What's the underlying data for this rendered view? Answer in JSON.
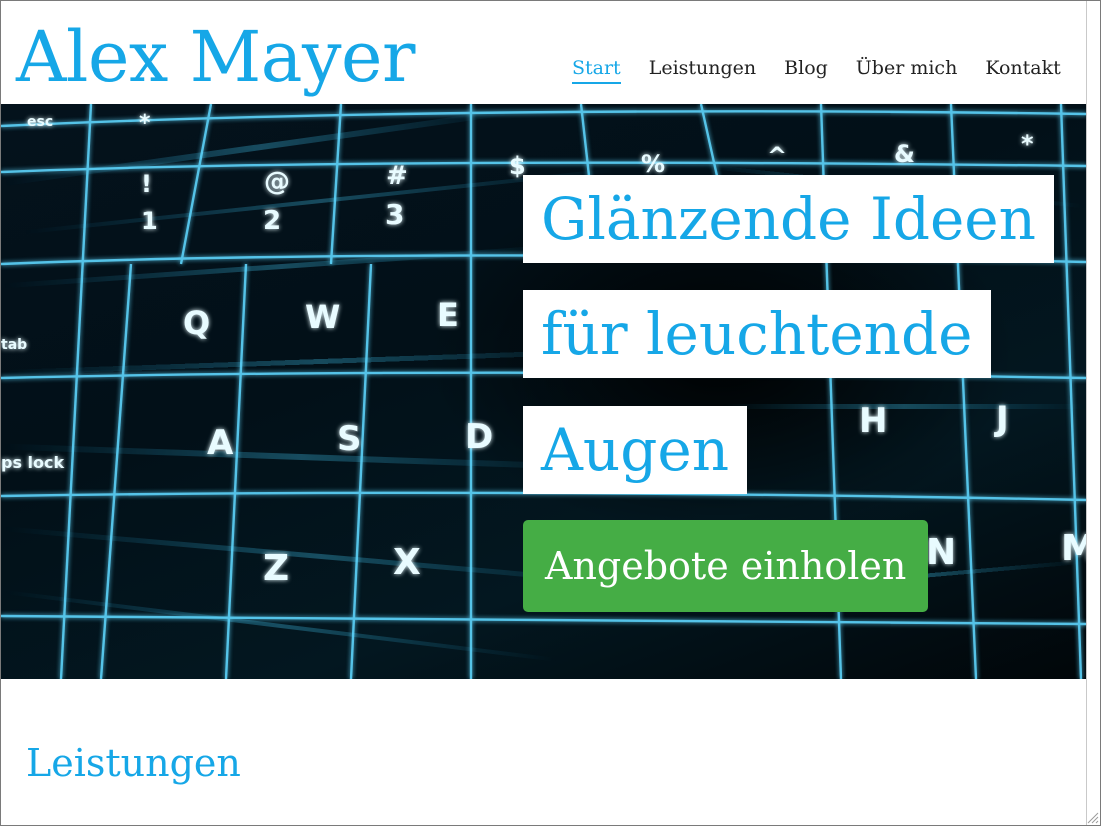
{
  "site": {
    "logo": "Alex Mayer"
  },
  "nav": {
    "items": [
      {
        "label": "Start",
        "active": true
      },
      {
        "label": "Leistungen",
        "active": false
      },
      {
        "label": "Blog",
        "active": false
      },
      {
        "label": "Über mich",
        "active": false
      },
      {
        "label": "Kontakt",
        "active": false
      }
    ]
  },
  "hero": {
    "headline_lines": [
      "Glänzende Ideen",
      "für leuchtende",
      "Augen"
    ],
    "cta_label": "Angebote einholen",
    "background_image": "glowing-keyboard-image"
  },
  "keyboard_keys": {
    "row1": [
      "*",
      "\"",
      "",
      "$",
      "%",
      "^",
      "&",
      "*"
    ],
    "row2": [
      "!\n1",
      "@\n2",
      "#\n3"
    ],
    "row3": [
      "Q",
      "W",
      "E"
    ],
    "row4": [
      "A",
      "S",
      "D",
      "H",
      "J"
    ],
    "row5": [
      "Z",
      "X",
      "N",
      "M"
    ],
    "side_labels": [
      "esc",
      "tab",
      "ps lock"
    ]
  },
  "section": {
    "title": "Leistungen"
  },
  "colors": {
    "accent": "#16a7e7",
    "cta": "#45ad45",
    "glow": "#5fd8ff"
  }
}
